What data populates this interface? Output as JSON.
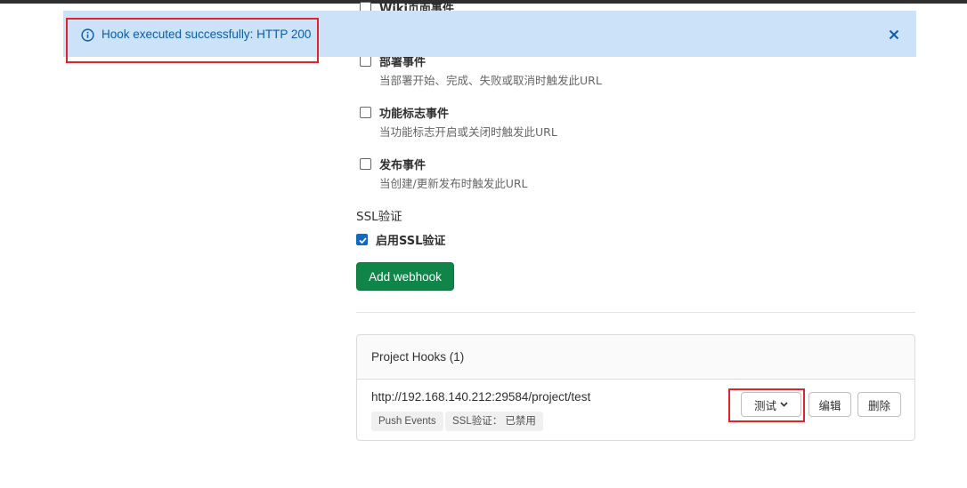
{
  "alert": {
    "message": "Hook executed successfully: HTTP 200",
    "icon": "info-circle-icon",
    "close_icon": "close-icon",
    "color": "#0b5cad",
    "background": "#cbe2f9"
  },
  "events": [
    {
      "title": "Wiki页面事件",
      "description": "",
      "checked": false
    },
    {
      "title": "部署事件",
      "description": "当部署开始、完成、失败或取消时触发此URL",
      "checked": false
    },
    {
      "title": "功能标志事件",
      "description": "当功能标志开启或关闭时触发此URL",
      "checked": false
    },
    {
      "title": "发布事件",
      "description": "当创建/更新发布时触发此URL",
      "checked": false
    }
  ],
  "ssl": {
    "heading": "SSL验证",
    "checkbox_label": "启用SSL验证",
    "checked": true
  },
  "add_webhook_label": "Add webhook",
  "hooks": {
    "title": "Project Hooks (1)",
    "items": [
      {
        "url": "http://192.168.140.212:29584/project/test",
        "badges": [
          "Push Events",
          "SSL验证： 已禁用"
        ],
        "test_label": "测试",
        "edit_label": "编辑",
        "delete_label": "删除"
      }
    ]
  },
  "colors": {
    "primary_button": "#108548",
    "checkbox_checked": "#1068bf",
    "annotation": "#e0242b"
  }
}
